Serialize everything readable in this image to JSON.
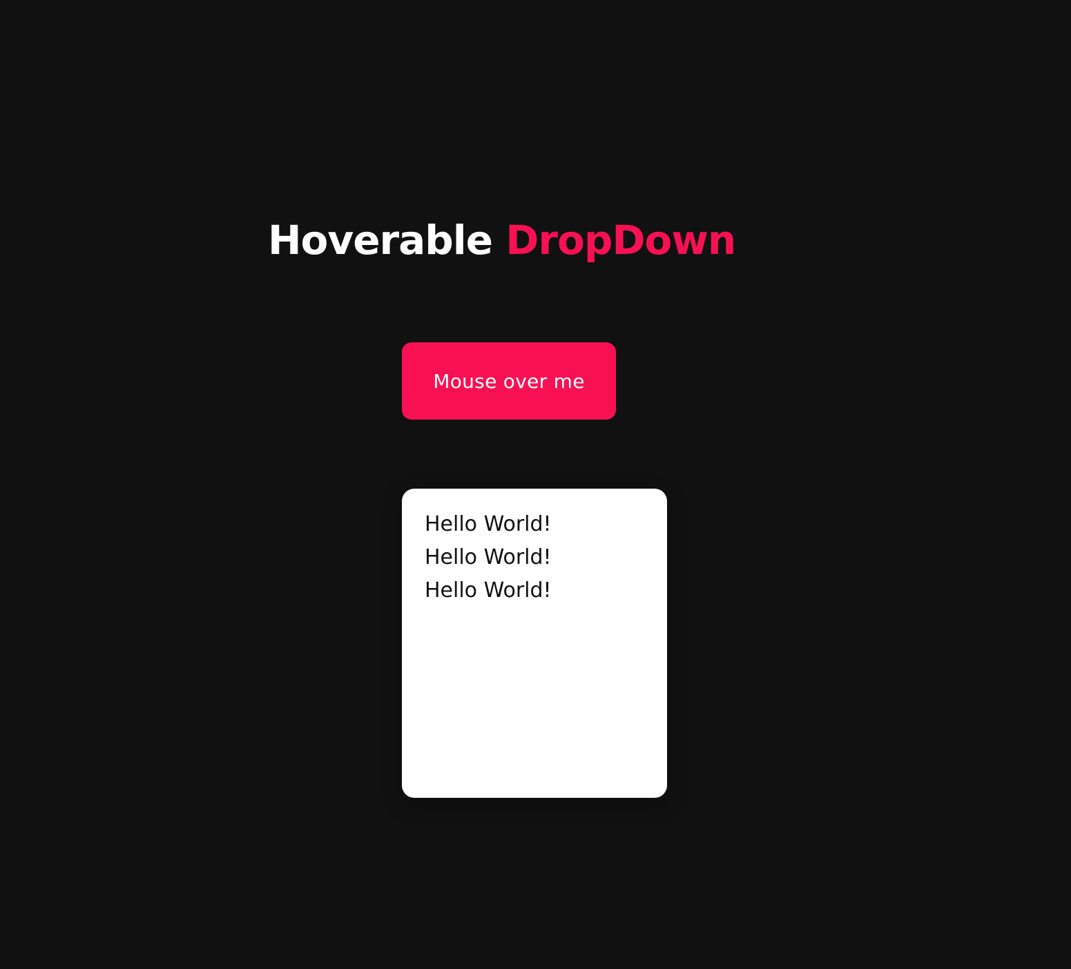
{
  "title": {
    "part1": "Hoverable",
    "part2": "DropDown"
  },
  "button": {
    "label": "Mouse over me"
  },
  "dropdown": {
    "items": [
      {
        "label": "Hello World!"
      },
      {
        "label": "Hello World!"
      },
      {
        "label": "Hello World!"
      }
    ]
  },
  "colors": {
    "background": "#111111",
    "accent": "#f81152",
    "text_light": "#ffffff",
    "menu_bg": "#ffffff",
    "menu_text": "#111111"
  }
}
